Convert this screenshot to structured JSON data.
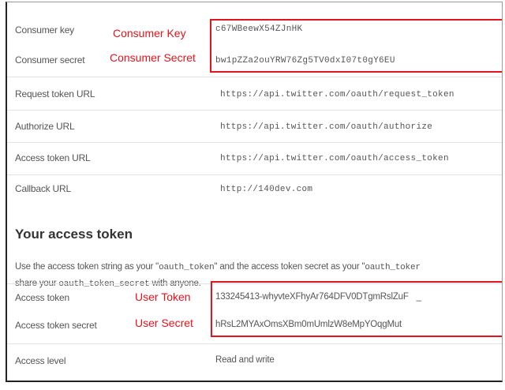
{
  "app_settings": {
    "rows": [
      {
        "label": "Consumer key",
        "value": "c67WBeewX54ZJnHK",
        "annotation": "Consumer Key"
      },
      {
        "label": "Consumer secret",
        "value": "bw1pZZa2ouYRW76Zg5TV0dxI07t0gY6EU",
        "annotation": "Consumer Secret"
      },
      {
        "label": "Request token URL",
        "value": "https://api.twitter.com/oauth/request_token"
      },
      {
        "label": "Authorize URL",
        "value": "https://api.twitter.com/oauth/authorize"
      },
      {
        "label": "Access token URL",
        "value": "https://api.twitter.com/oauth/access_token"
      },
      {
        "label": "Callback URL",
        "value": "http://140dev.com"
      }
    ]
  },
  "access_token_section": {
    "heading": "Your access token",
    "desc_part1": "Use the access token string as your \"",
    "desc_code1": "oauth_token",
    "desc_part2": "\" and the access token secret as your \"",
    "desc_code2": "oauth_toker",
    "desc_line2_part1": "share your ",
    "desc_code3": "oauth_token_secret",
    "desc_line2_part2": " with anyone.",
    "rows": [
      {
        "label": "Access token",
        "value": "133245413-whyvteXFhyAr764DFV0DTgmRslZuF",
        "trail": "_",
        "annotation": "User Token"
      },
      {
        "label": "Access token secret",
        "value": "hRsL2MYAxOmsXBm0mUmlzW8eMpYOqgMut",
        "annotation": "User Secret"
      },
      {
        "label": "Access level",
        "value": "Read and write"
      }
    ]
  },
  "colors": {
    "annotation_red": "#e5131c",
    "text_gray": "#555555",
    "heading": "#333333"
  }
}
